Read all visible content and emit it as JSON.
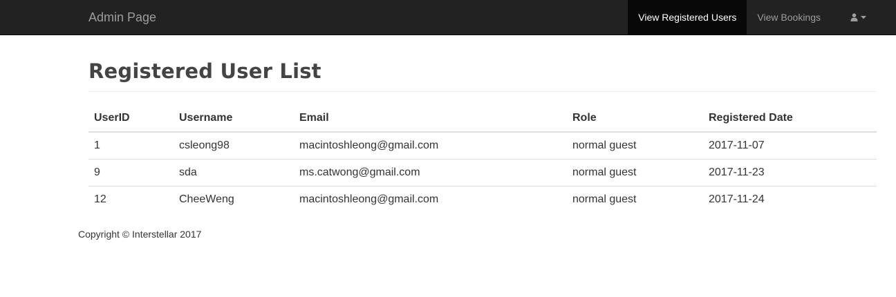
{
  "navbar": {
    "brand": "Admin Page",
    "links": [
      {
        "label": "View Registered Users",
        "active": true
      },
      {
        "label": "View Bookings",
        "active": false
      }
    ],
    "user_menu_icon": "user-icon",
    "caret_icon": "caret-down-icon"
  },
  "main": {
    "title": "Registered User List",
    "table": {
      "headers": [
        "UserID",
        "Username",
        "Email",
        "Role",
        "Registered Date"
      ],
      "rows": [
        [
          "1",
          "csleong98",
          "macintoshleong@gmail.com",
          "normal guest",
          "2017-11-07"
        ],
        [
          "9",
          "sda",
          "ms.catwong@gmail.com",
          "normal guest",
          "2017-11-23"
        ],
        [
          "12",
          "CheeWeng",
          "macintoshleong@gmail.com",
          "normal guest",
          "2017-11-24"
        ]
      ]
    }
  },
  "footer": {
    "text": "Copyright © Interstellar 2017"
  },
  "colors": {
    "navbar_bg": "#222222",
    "active_link_bg": "#080808",
    "nav_text": "#9d9d9d",
    "active_text": "#ffffff"
  }
}
